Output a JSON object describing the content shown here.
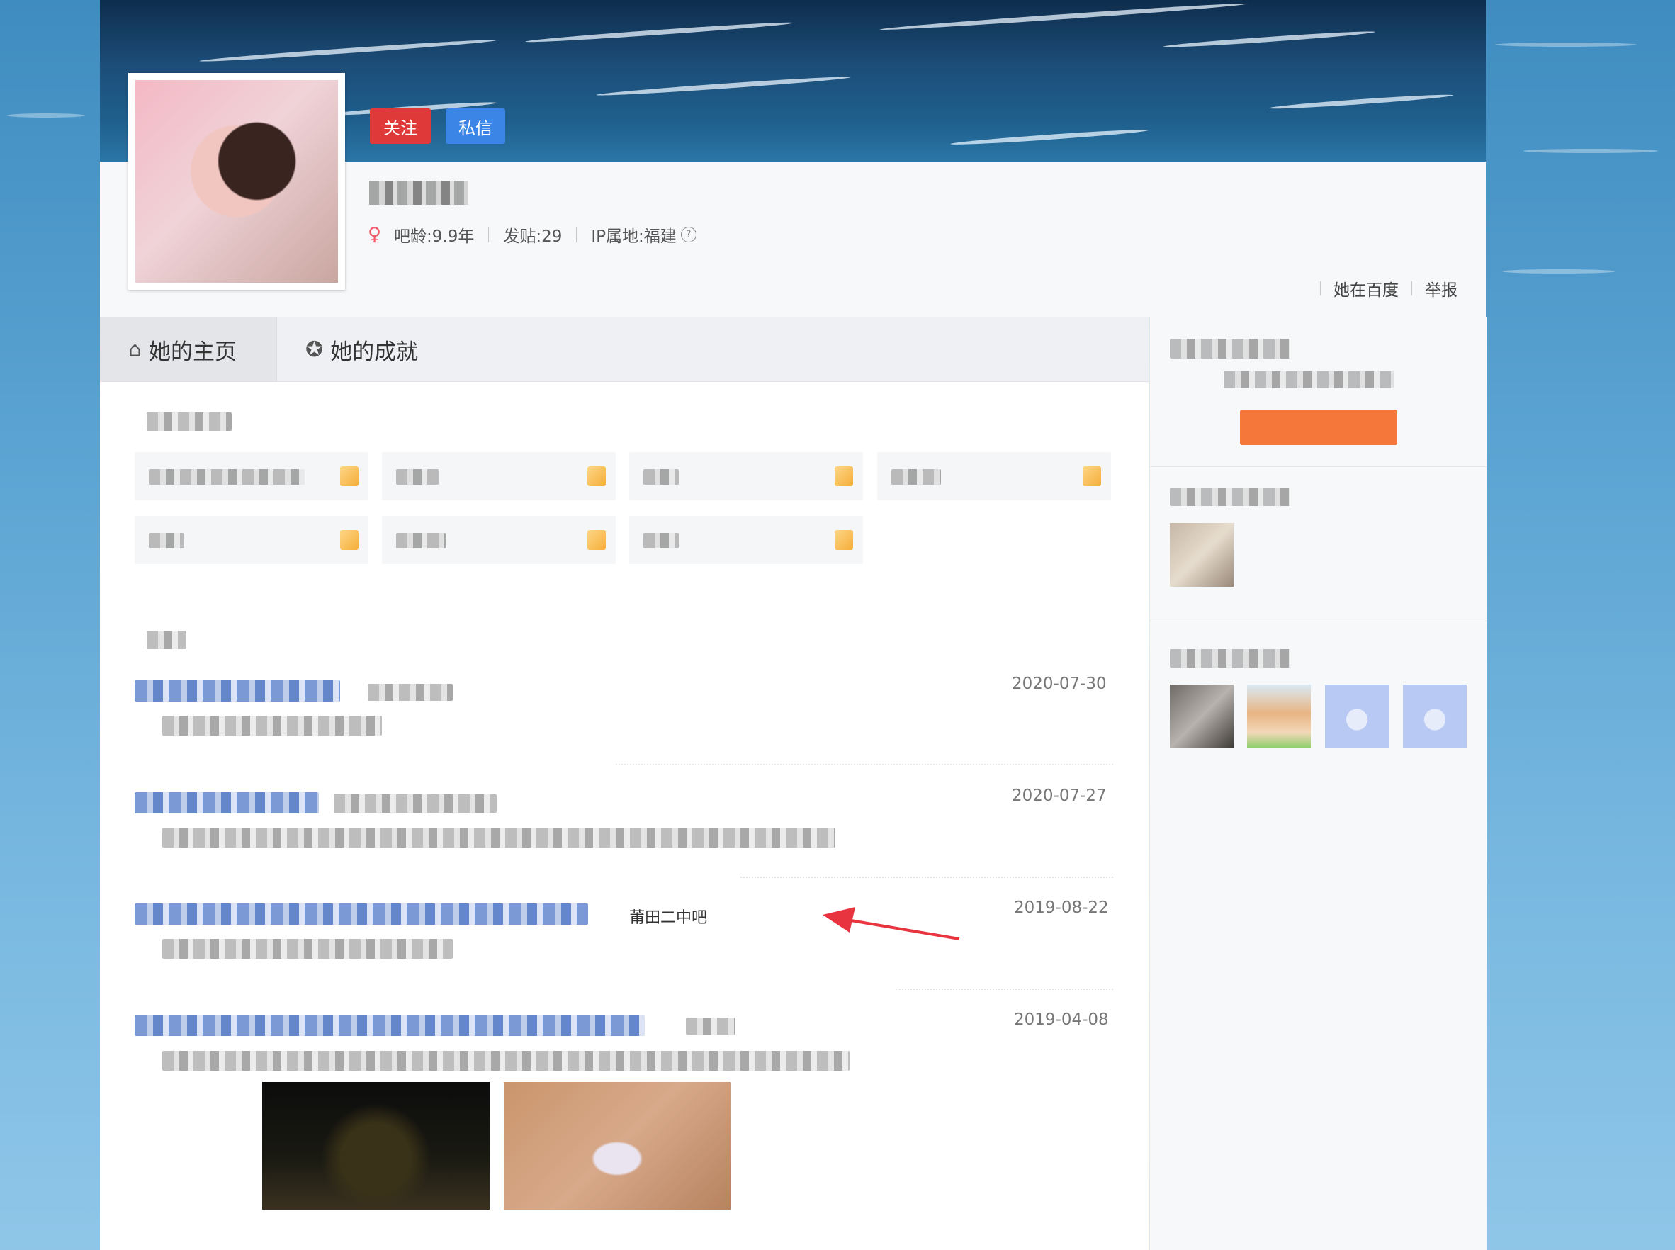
{
  "profile": {
    "follow_label": "关注",
    "message_label": "私信",
    "gender_icon": "female-pin-icon",
    "bar_age": "吧龄:9.9年",
    "post_count": "发贴:29",
    "ip_location": "IP属地:福建",
    "help_icon": "?"
  },
  "top_links": {
    "baidu": "她在百度",
    "report": "举报"
  },
  "tabs": [
    {
      "label": "她的主页",
      "icon": "home-icon"
    },
    {
      "label": "她的成就",
      "icon": "award-icon"
    }
  ],
  "posts": [
    {
      "date": "2020-07-30"
    },
    {
      "date": "2020-07-27"
    },
    {
      "date": "2019-08-22",
      "forum": "莆田二中吧"
    },
    {
      "date": "2019-04-08"
    }
  ],
  "colors": {
    "follow": "#e0393a",
    "message": "#3a85e6",
    "annotation_arrow": "#e8343f",
    "sidebar_button": "#f5773a"
  }
}
